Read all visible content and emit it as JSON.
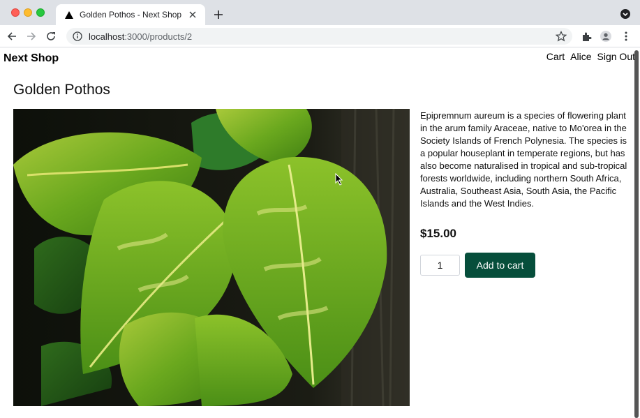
{
  "browser": {
    "tab_title": "Golden Pothos - Next Shop",
    "url_host": "localhost",
    "url_path": ":3000/products/2"
  },
  "nav": {
    "brand": "Next Shop",
    "links": [
      "Cart",
      "Alice",
      "Sign Out"
    ]
  },
  "product": {
    "title": "Golden Pothos",
    "description": "Epipremnum aureum is a species of flowering plant in the arum family Araceae, native to Mo'orea in the Society Islands of French Polynesia. The species is a popular houseplant in temperate regions, but has also become naturalised in tropical and sub-tropical forests worldwide, including northern South Africa, Australia, Southeast Asia, South Asia, the Pacific Islands and the West Indies.",
    "price": "$15.00",
    "quantity": "1",
    "add_to_cart_label": "Add to cart"
  },
  "colors": {
    "accent": "#064e3b",
    "tabstrip": "#dee1e6"
  }
}
